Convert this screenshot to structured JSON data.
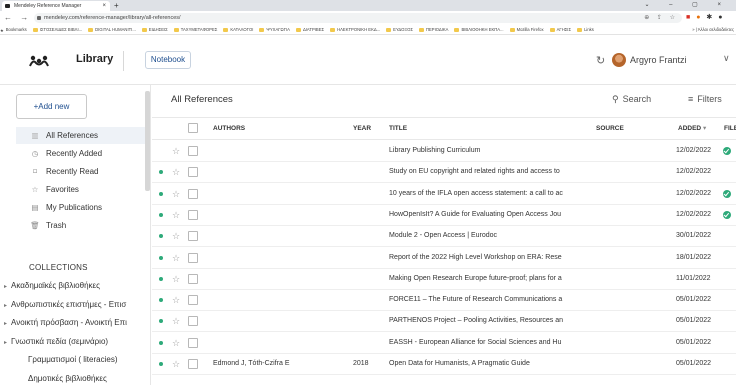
{
  "browser": {
    "tab_title": "Mendeley Reference Manager",
    "tab_close": "×",
    "new_tab": "+",
    "window_controls": "⌄ – ▢ ×",
    "nav_buttons": "← → C",
    "url": "mendeley.com/reference-manager/library/all-references/",
    "omnibox_icons": "⊕ ⇪ ☆",
    "bookmarks": [
      {
        "label": "Bookmarks",
        "star": true
      },
      {
        "label": "ΙΣΤΟΣΕΛΙΔΕΣ ΒΙΒΛΙ..."
      },
      {
        "label": "DIGITAL HUMANITI..."
      },
      {
        "label": "ΕΙΔΗΣΕΙΣ"
      },
      {
        "label": "ΤΑΧΥΜΕΤΑΦΟΡΕΣ"
      },
      {
        "label": "ΚΑΤΑΛΟΓΟΙ"
      },
      {
        "label": "ΨΥΧΑΓΩΓΙΑ"
      },
      {
        "label": "ΔΙΑΤΡΙΒΕΣ"
      },
      {
        "label": "ΗΛΕΚΤΡΟΝΙΚΗ ΕΚΔ..."
      },
      {
        "label": "ΕΥΔΟΞΟΣ"
      },
      {
        "label": "ΠΕΡΙΟΔΙΚΑ"
      },
      {
        "label": "ΒΙΒΛΙΟΘΗΚΗ ΕΚΠΑ..."
      },
      {
        "label": "Mozilla Firefox"
      },
      {
        "label": "ΑΓΗΣΙΣ"
      },
      {
        "label": "Links"
      }
    ],
    "bookmarks_right": "» | Άλλοι σελιδοδείκτες"
  },
  "header": {
    "app_title": "Library",
    "notebook_label": "Notebook",
    "user_name": "Argyro Frantzi",
    "sync_icon": "↻",
    "chevron": "∨"
  },
  "sidebar": {
    "add_new_label": "+Add new",
    "items": [
      {
        "label": "All References",
        "icon": "▥",
        "active": true
      },
      {
        "label": "Recently Added",
        "icon": "◷"
      },
      {
        "label": "Recently Read",
        "icon": "⌑"
      },
      {
        "label": "Favorites",
        "icon": "☆"
      },
      {
        "label": "My Publications",
        "icon": "▤"
      },
      {
        "label": "Trash",
        "icon": "🗑"
      }
    ],
    "collections_header": "COLLECTIONS",
    "collections": [
      {
        "label": "Ακαδημαϊκές βιβλιοθήκες",
        "chevron": true
      },
      {
        "label": "Ανθρωπιστικές επιστήμες - Επισ",
        "chevron": true
      },
      {
        "label": "Ανοικτή πρόσβαση - Ανοικτή Επι",
        "chevron": true
      },
      {
        "label": "Γνωστικά πεδία (σεμινάριο)",
        "chevron": true
      },
      {
        "label": "Γραμματισμοί ( literacies)",
        "chevron": false
      },
      {
        "label": "Δημοτικές βιβλιοθήκες",
        "chevron": false
      }
    ]
  },
  "main": {
    "title": "All References",
    "search_label": "Search",
    "filters_label": "Filters",
    "columns": {
      "authors": "AUTHORS",
      "year": "YEAR",
      "title": "TITLE",
      "source": "SOURCE",
      "added": "ADDED",
      "added_sort": "▾",
      "file": "FILE"
    },
    "rows": [
      {
        "dot": false,
        "authors": "",
        "year": "",
        "title": "Library Publishing Curriculum",
        "added": "12/02/2022",
        "file": true
      },
      {
        "dot": true,
        "authors": "",
        "year": "",
        "title": "Study on EU copyright and related rights and access to",
        "added": "12/02/2022",
        "file": false
      },
      {
        "dot": true,
        "authors": "",
        "year": "",
        "title": "10 years of the IFLA open access statement: a call to ac",
        "added": "12/02/2022",
        "file": true
      },
      {
        "dot": true,
        "authors": "",
        "year": "",
        "title": "HowOpenIsIt? A Guide for Evaluating Open Access Jou",
        "added": "12/02/2022",
        "file": true
      },
      {
        "dot": true,
        "authors": "",
        "year": "",
        "title": "Module 2 - Open Access | Eurodoc",
        "added": "30/01/2022",
        "file": false
      },
      {
        "dot": true,
        "authors": "",
        "year": "",
        "title": "Report of the 2022 High Level Workshop on ERA: Rese",
        "added": "18/01/2022",
        "file": false
      },
      {
        "dot": true,
        "authors": "",
        "year": "",
        "title": "Making Open Research Europe future-proof; plans for a",
        "added": "11/01/2022",
        "file": false
      },
      {
        "dot": true,
        "authors": "",
        "year": "",
        "title": "FORCE11 – The Future of Research Communications a",
        "added": "05/01/2022",
        "file": false
      },
      {
        "dot": true,
        "authors": "",
        "year": "",
        "title": "PARTHENOS Project – Pooling Activities, Resources an",
        "added": "05/01/2022",
        "file": false
      },
      {
        "dot": true,
        "authors": "",
        "year": "",
        "title": "EASSH - European Alliance for Social Sciences and Hu",
        "added": "05/01/2022",
        "file": false
      },
      {
        "dot": true,
        "authors": "Edmond J, Tóth-Czifra E",
        "year": "2018",
        "title": "Open Data for Humanists, A Pragmatic Guide",
        "added": "05/01/2022",
        "file": false
      }
    ]
  },
  "colors": {
    "accent": "#1f4f8f",
    "read_dot": "#2eaa7a",
    "active_bg": "#eef2f7"
  }
}
